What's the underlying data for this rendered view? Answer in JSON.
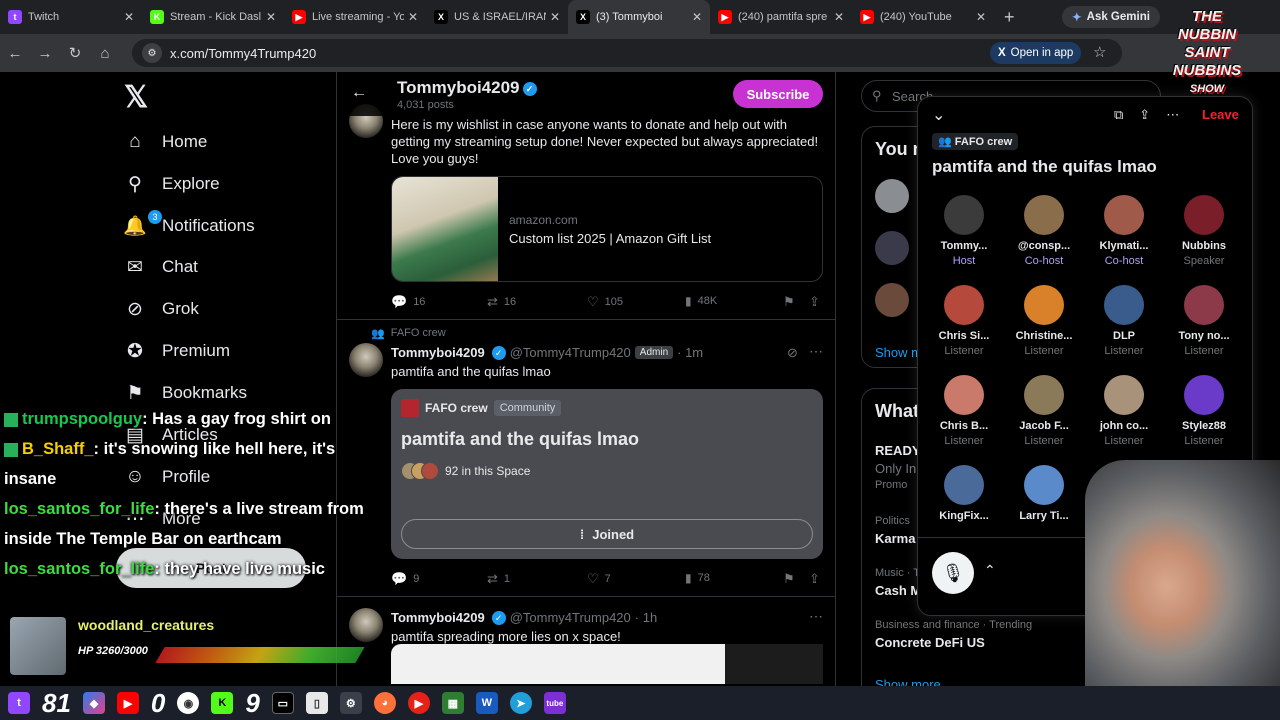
{
  "browser": {
    "tabs": [
      {
        "label": "Twitch",
        "color": "#9146ff",
        "glyph": "t"
      },
      {
        "label": "Stream - Kick Dasl",
        "color": "#53fc18",
        "glyph": "K"
      },
      {
        "label": "Live streaming - Yo",
        "color": "#ff0000",
        "glyph": "▶"
      },
      {
        "label": "US & ISRAEL/IRAN",
        "color": "#000000",
        "glyph": "X"
      },
      {
        "label": "(3) Tommyboi",
        "color": "#000000",
        "glyph": "X"
      },
      {
        "label": "(240) pamtifa spre",
        "color": "#ff0000",
        "glyph": "▶"
      },
      {
        "label": "(240) YouTube",
        "color": "#ff0000",
        "glyph": "▶"
      }
    ],
    "gemini_label": "Ask Gemini",
    "url": "x.com/Tommy4Trump420",
    "open_in_app": "Open in app"
  },
  "nav": {
    "items": [
      {
        "label": "Home",
        "icon": "⌂"
      },
      {
        "label": "Explore",
        "icon": "⚲"
      },
      {
        "label": "Notifications",
        "icon": "🔔"
      },
      {
        "label": "Chat",
        "icon": "✉"
      },
      {
        "label": "Grok",
        "icon": "⊘"
      },
      {
        "label": "Premium",
        "icon": "✪"
      },
      {
        "label": "Bookmarks",
        "icon": "⚑"
      },
      {
        "label": "Articles",
        "icon": "▤"
      },
      {
        "label": "Profile",
        "icon": "☺"
      },
      {
        "label": "More",
        "icon": "⋯"
      }
    ],
    "notif_count": "3",
    "post_label": "Post"
  },
  "feed": {
    "name": "Tommyboi4209",
    "posts_count": "4,031 posts",
    "subscribe": "Subscribe",
    "post1": {
      "text": "Here is my wishlist in case anyone wants to donate and help out with getting my streaming setup done! Never expected but always appreciated! Love you guys!",
      "link_domain": "amazon.com",
      "link_title": "Custom list 2025 | Amazon Gift List",
      "replies": "16",
      "reposts": "16",
      "likes": "105",
      "views": "48K"
    },
    "post2": {
      "community": "FAFO crew",
      "name": "Tommyboi4209",
      "handle": "@Tommy4Trump420",
      "admin": "Admin",
      "time": "· 1m",
      "text": "pamtifa and the quifas lmao",
      "card_community": "FAFO crew",
      "card_badge": "Community",
      "card_title": "pamtifa and the quifas lmao",
      "card_count": "92 in this Space",
      "joined": "Joined",
      "replies": "9",
      "reposts": "1",
      "likes": "7",
      "views": "78"
    },
    "post3": {
      "name": "Tommyboi4209",
      "handle": "@Tommy4Trump420",
      "time": "· 1h",
      "text": "pamtifa spreading more lies on x space!"
    }
  },
  "right": {
    "search_placeholder": "Search",
    "you_might_like": "You m",
    "show_more_1": "Show m",
    "whats_happening": "What",
    "trend1_title": "READY",
    "trend1_sub": "Only In",
    "trend1_promo": "Promo",
    "trend2_cat": "Politics",
    "trend2_title": "Karma",
    "trend3_cat": "Music · T",
    "trend3_title": "Cash M",
    "trend4_cat": "Business and finance · Trending",
    "trend4_title": "Concrete DeFi US",
    "show_more_2": "Show more"
  },
  "space": {
    "leave": "Leave",
    "community": "FAFO crew",
    "title": "pamtifa and the quifas lmao",
    "participants": [
      {
        "name": "Tommy...",
        "role": "Host",
        "color": "#3b3b3b"
      },
      {
        "name": "@consp...",
        "role": "Co-host",
        "color": "#8a6d4a"
      },
      {
        "name": "Klymati...",
        "role": "Co-host",
        "color": "#a05a4a"
      },
      {
        "name": "Nubbins",
        "role": "Speaker",
        "color": "#7a1f2a"
      },
      {
        "name": "Chris Si...",
        "role": "Listener",
        "color": "#b54a3c"
      },
      {
        "name": "Christine...",
        "role": "Listener",
        "color": "#d9802a"
      },
      {
        "name": "DLP",
        "role": "Listener",
        "color": "#3a5c8c"
      },
      {
        "name": "Tony no...",
        "role": "Listener",
        "color": "#8c3a4a"
      },
      {
        "name": "Chris B...",
        "role": "Listener",
        "color": "#c97a6a"
      },
      {
        "name": "Jacob F...",
        "role": "Listener",
        "color": "#8a7a5a"
      },
      {
        "name": "john co...",
        "role": "Listener",
        "color": "#a8927a"
      },
      {
        "name": "Stylez88",
        "role": "Listener",
        "color": "#6a3ac9"
      },
      {
        "name": "KingFix...",
        "role": "",
        "color": "#4a6a9a"
      },
      {
        "name": "Larry Ti...",
        "role": "",
        "color": "#5a8ac9"
      },
      {
        "name": "",
        "role": "",
        "color": "#c94a3a"
      }
    ]
  },
  "stream": {
    "chat": [
      {
        "user": "trumpspoolguy",
        "msg": ": Has a gay frog shirt on"
      },
      {
        "user": "B_Shaff_",
        "msg": ": it's snowing like hell here, it's insane"
      },
      {
        "user": "los_santos_for_life",
        "msg": ": there's a live stream from inside The Temple Bar on earthcam"
      },
      {
        "user": "los_santos_for_life",
        "msg": ": they have live music"
      }
    ],
    "follower_name": "woodland_creatures",
    "follower_hp": "HP 3260/3000",
    "logo_line1": "THE",
    "logo_line2": "NUBBIN",
    "logo_line3": "SAINT",
    "logo_line4": "NUBBINS",
    "logo_line5": "SHOW",
    "taskbar_count1": "81",
    "taskbar_count2": "0",
    "taskbar_count3": "9"
  }
}
